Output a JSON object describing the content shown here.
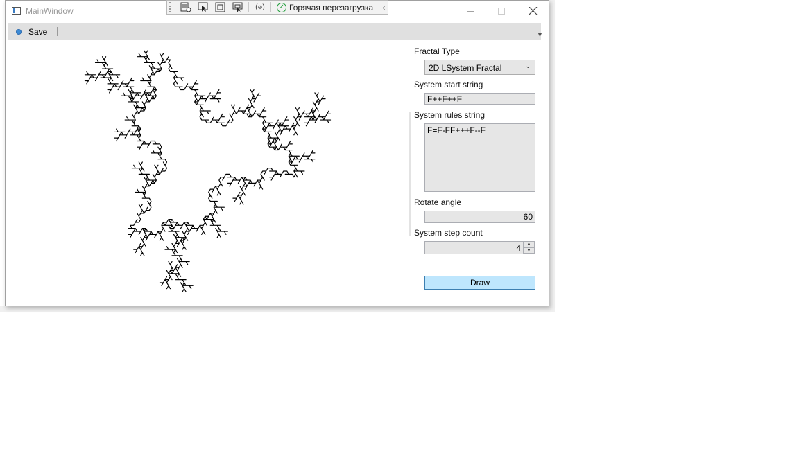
{
  "window": {
    "title": "MainWindow"
  },
  "devbar": {
    "hot_reload_label": "Горячая перезагрузка"
  },
  "toolbar": {
    "save_label": "Save"
  },
  "panel": {
    "fractal_type_label": "Fractal Type",
    "fractal_type_value": "2D LSystem Fractal",
    "start_string_label": "System start string",
    "start_string_value": "F++F++F",
    "rules_label": "System rules string",
    "rules_value": "F=F-FF+++F--F",
    "angle_label": "Rotate angle",
    "angle_value": "60",
    "step_count_label": "System step count",
    "step_count_value": "4",
    "draw_label": "Draw"
  },
  "colors": {
    "draw_button": "#bee6fd",
    "accent": "#3c7fb1"
  }
}
